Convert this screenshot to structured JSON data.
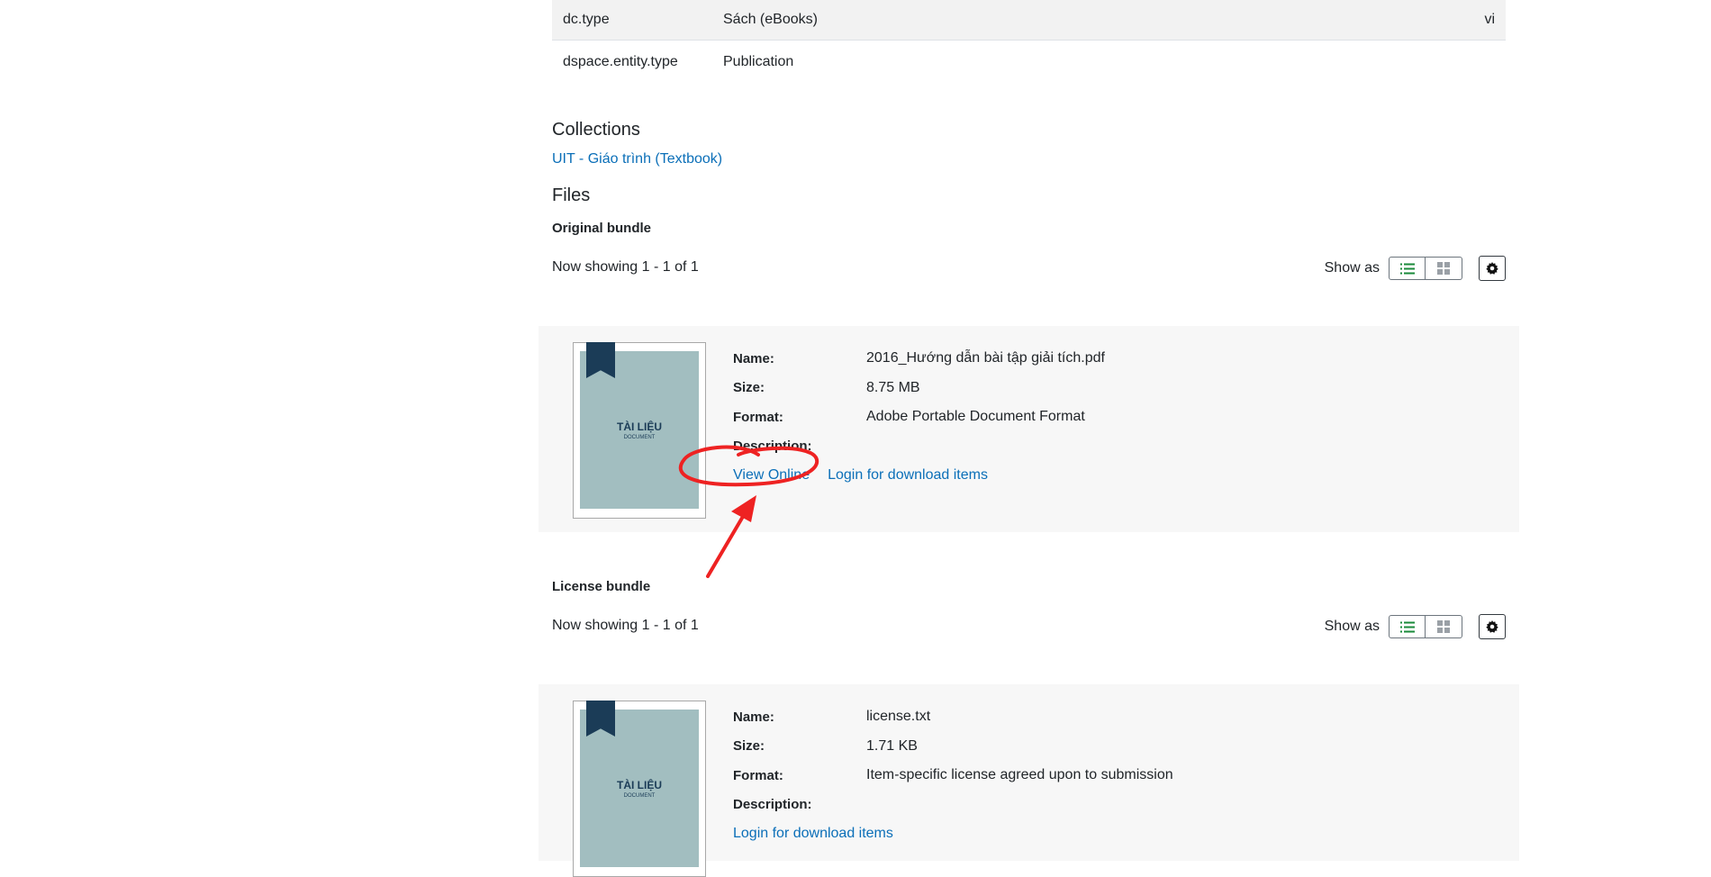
{
  "metadata": [
    {
      "key": "dc.type",
      "value": "Sách (eBooks)",
      "lang": "vi"
    },
    {
      "key": "dspace.entity.type",
      "value": "Publication",
      "lang": ""
    }
  ],
  "collections": {
    "heading": "Collections",
    "link": "UIT - Giáo trình (Textbook)"
  },
  "files": {
    "heading": "Files",
    "show_as_label": "Show as",
    "bundles": [
      {
        "title": "Original bundle",
        "showing": "Now showing 1 - 1 of 1",
        "file": {
          "thumb_title": "TÀI LIỆU",
          "thumb_sub": "DOCUMENT",
          "labels": {
            "name": "Name:",
            "size": "Size:",
            "format": "Format:",
            "description": "Description:"
          },
          "name": "2016_Hướng dẫn bài tập giải tích.pdf",
          "size": "8.75 MB",
          "format": "Adobe Portable Document Format",
          "description": "",
          "view_online": "View Online",
          "login": "Login for download items"
        }
      },
      {
        "title": "License bundle",
        "showing": "Now showing 1 - 1 of 1",
        "file": {
          "thumb_title": "TÀI LIỆU",
          "thumb_sub": "DOCUMENT",
          "labels": {
            "name": "Name:",
            "size": "Size:",
            "format": "Format:",
            "description": "Description:"
          },
          "name": "license.txt",
          "size": "1.71 KB",
          "format": "Item-specific license agreed upon to submission",
          "description": "",
          "login": "Login for download items"
        }
      }
    ]
  },
  "annotation": {
    "color": "#ee2222"
  },
  "icons": {
    "list": "list-view-icon",
    "grid": "grid-view-icon",
    "settings": "gear-icon"
  }
}
